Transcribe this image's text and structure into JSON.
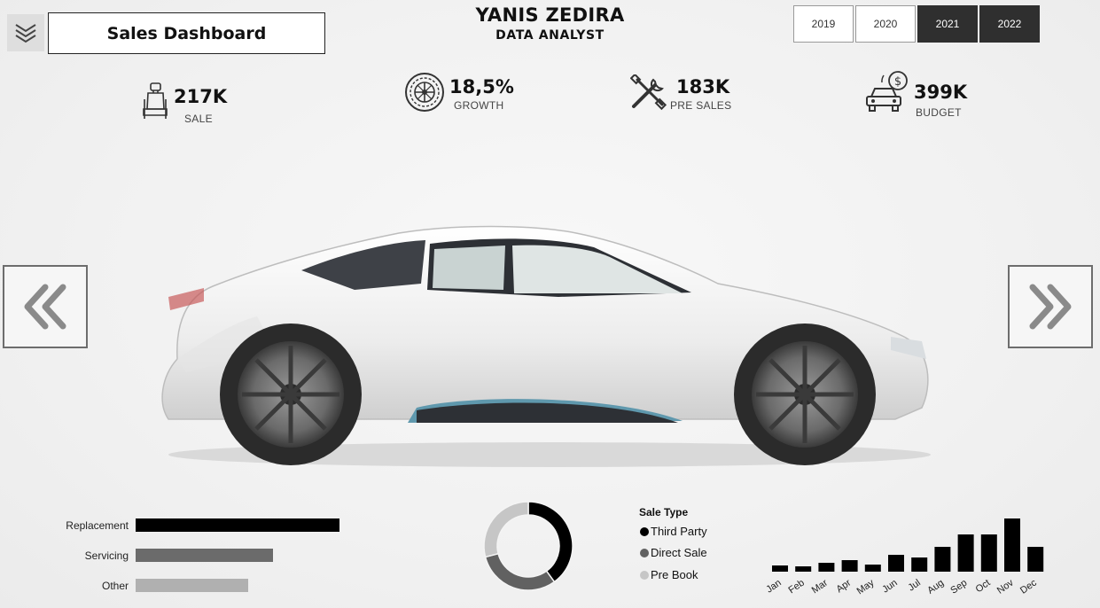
{
  "header": {
    "title": "Sales Dashboard",
    "analyst_name": "YANIS ZEDIRA",
    "analyst_role": "DATA ANALYST",
    "menu_icon": "chevrons-down-icon"
  },
  "years": [
    {
      "label": "2019",
      "active": false
    },
    {
      "label": "2020",
      "active": false
    },
    {
      "label": "2021",
      "active": true
    },
    {
      "label": "2022",
      "active": true
    }
  ],
  "kpis": {
    "sale": {
      "value": "217K",
      "label": "SALE",
      "icon": "car-seat-icon"
    },
    "growth": {
      "value": "18,5%",
      "label": "GROWTH",
      "icon": "tire-icon"
    },
    "pre_sales": {
      "value": "183K",
      "label": "PRE SALES",
      "icon": "tools-icon"
    },
    "budget": {
      "value": "399K",
      "label": "BUDGET",
      "icon": "car-dollar-icon"
    }
  },
  "navigation": {
    "prev_icon": "double-chevron-left-icon",
    "next_icon": "double-chevron-right-icon"
  },
  "colors": {
    "bar_dark": "#000000",
    "bar_mid": "#6b6b6b",
    "bar_light": "#b0b0b0",
    "accent": "#2f2f2f"
  },
  "chart_data": [
    {
      "type": "bar",
      "orientation": "horizontal",
      "categories": [
        "Replacement",
        "Servicing",
        "Other"
      ],
      "values": [
        230,
        155,
        127
      ]
    },
    {
      "type": "pie",
      "style": "donut",
      "title": "Sale Type",
      "categories": [
        "Third Party",
        "Direct Sale",
        "Pre Book"
      ],
      "values": [
        40,
        31,
        29
      ],
      "colors": [
        "#000000",
        "#616161",
        "#c6c6c6"
      ],
      "legend": "right"
    },
    {
      "type": "bar",
      "categories": [
        "Jan",
        "Feb",
        "Mar",
        "Apr",
        "May",
        "Jun",
        "Jul",
        "Aug",
        "Sep",
        "Oct",
        "Nov",
        "Dec"
      ],
      "values": [
        7,
        6,
        10,
        13,
        8,
        19,
        16,
        28,
        42,
        42,
        60,
        28
      ]
    }
  ]
}
